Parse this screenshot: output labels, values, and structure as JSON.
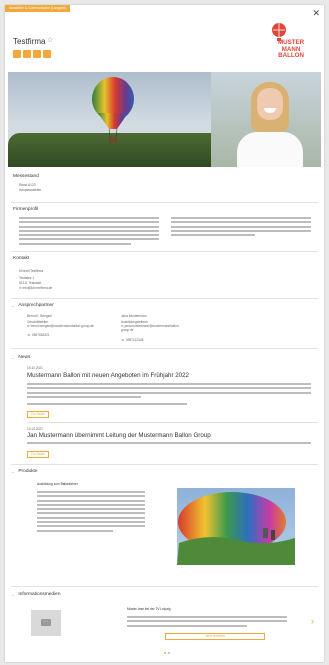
{
  "tag": "Aussteller & Communicator (Langzeit)",
  "firm": "Testfirma",
  "logo": {
    "line1": "MUSTER",
    "line2": "MANN",
    "line3": "BALLON",
    "color": "#e2463b"
  },
  "accent": "#f2a93b",
  "social": [
    "facebook-icon",
    "twitter-icon",
    "instagram-icon",
    "youtube-icon"
  ],
  "messestand": {
    "heading": "Messestand",
    "lines": [
      "Stand A123",
      "Hauptaussteller"
    ]
  },
  "firmenprofil": {
    "heading": "Firmenprofil"
  },
  "kontakt": {
    "heading": "Kontakt",
    "lines": [
      "Könner/Testfirma",
      "Testallee 1",
      "51311 Teststadt",
      "info@könnerfirma.de"
    ]
  },
  "ansprechpartner": {
    "heading": "Ansprechpartner",
    "people": [
      {
        "name": "Bernd K. Bengsel",
        "role": "Geschäftsleiter",
        "email": "bernd.bengsel@mustermannballon-group.de",
        "phone": "0987654321"
      },
      {
        "name": "Jana Mustermann",
        "role": "Ausbildungsleiterin",
        "email": "jana.mustermann@mustermannballon-group.de",
        "phone": "0987112345"
      }
    ]
  },
  "news": {
    "heading": "News",
    "items": [
      {
        "date": "19.10.2021",
        "title": "Mustermann Ballon mit neuen Angeboten im Frühjahr 2022",
        "more": "Zur News"
      },
      {
        "date": "10.10.2021",
        "title": "Jan Mustermann übernimmt Leitung der Mustermann Ballon Group",
        "more": "Zur News"
      }
    ]
  },
  "produkte": {
    "heading": "Produkte",
    "title": "Ausbildung zum Ballonfahrer"
  },
  "informationsmedien": {
    "heading": "Informationsmedien",
    "title": "Muster-Imm bei der TV Leipzig",
    "button": "Jetzt ansehen"
  },
  "close": "✕"
}
